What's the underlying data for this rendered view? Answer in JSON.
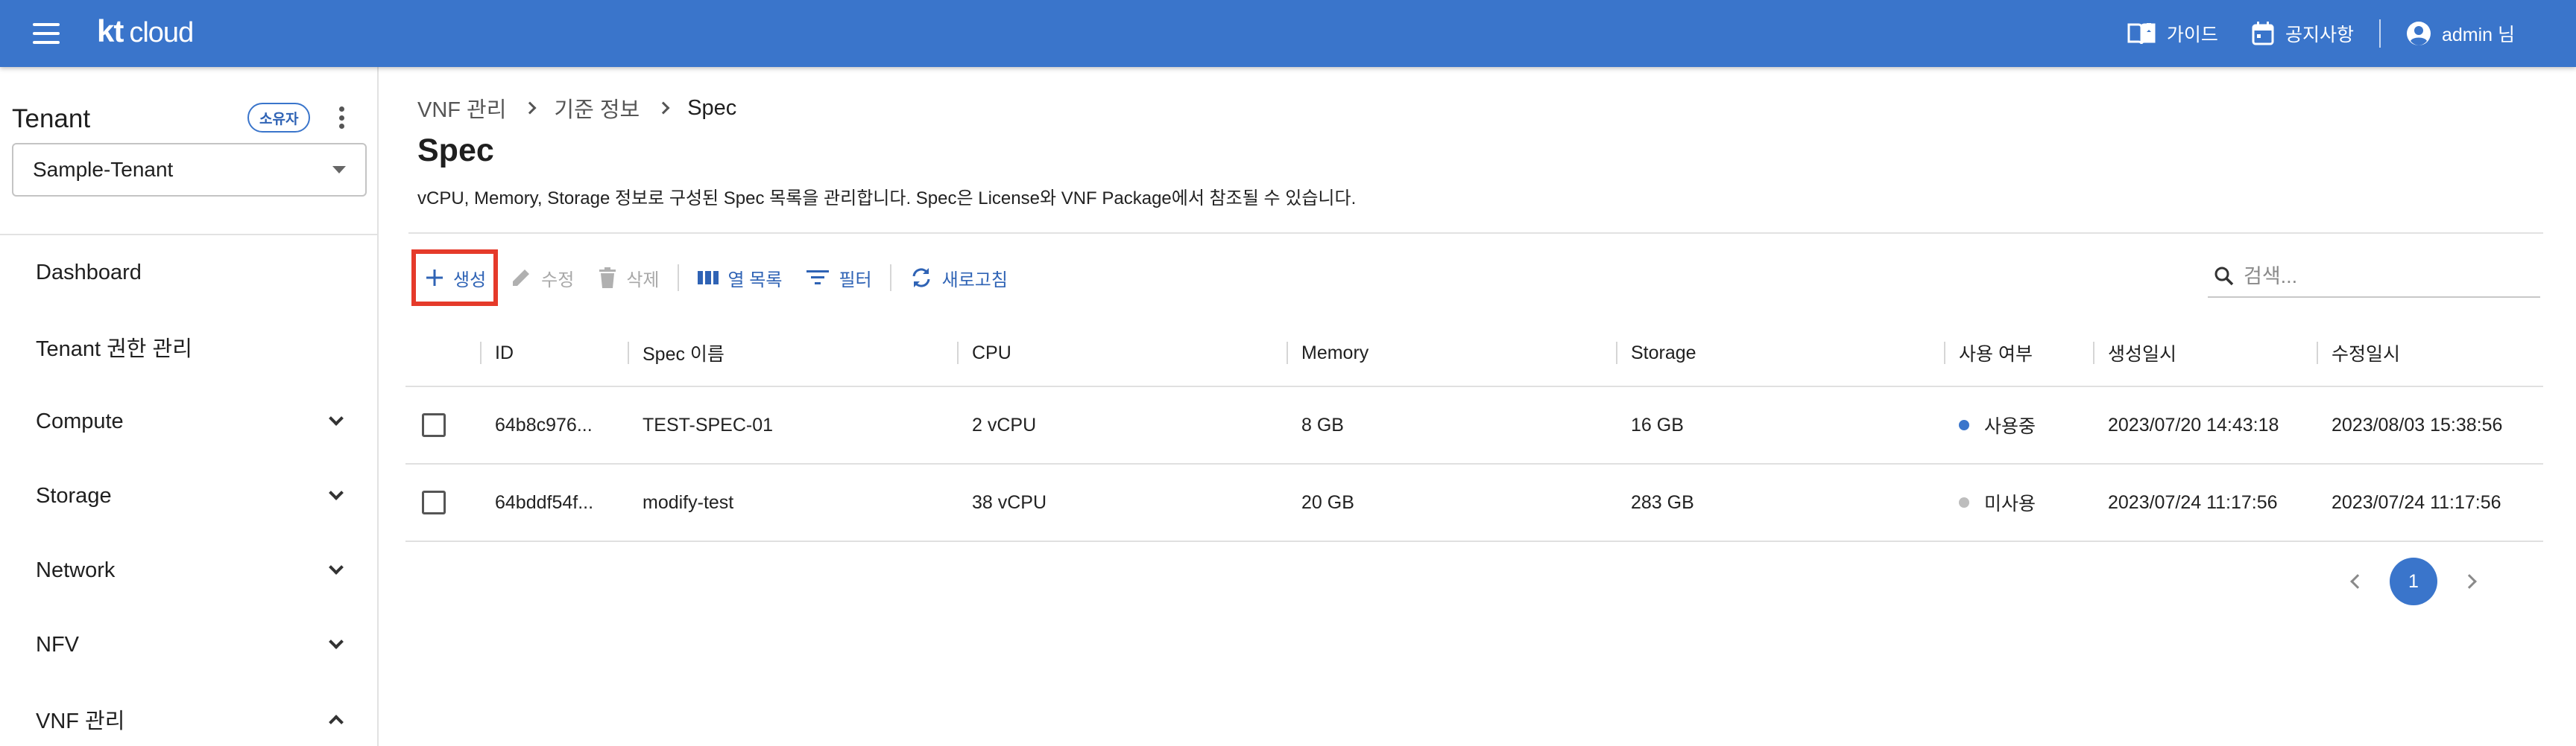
{
  "header": {
    "logo_kt": "kt",
    "logo_cloud": "cloud",
    "guide_label": "가이드",
    "notice_label": "공지사항",
    "user_label": "admin 님"
  },
  "sidebar": {
    "tenant_title": "Tenant",
    "owner_badge": "소유자",
    "tenant_selected": "Sample-Tenant",
    "items": [
      {
        "label": "Dashboard"
      },
      {
        "label": "Tenant 권한 관리"
      },
      {
        "label": "Compute"
      },
      {
        "label": "Storage"
      },
      {
        "label": "Network"
      },
      {
        "label": "NFV"
      },
      {
        "label": "VNF 관리"
      }
    ]
  },
  "breadcrumb": {
    "level1": "VNF 관리",
    "level2": "기준 정보",
    "current": "Spec"
  },
  "page": {
    "title": "Spec",
    "description": "vCPU, Memory, Storage 정보로 구성된 Spec 목록을 관리합니다. Spec은 License와 VNF Package에서 참조될 수 있습니다."
  },
  "toolbar": {
    "create_label": "생성",
    "edit_label": "수정",
    "delete_label": "삭제",
    "columns_label": "열 목록",
    "filter_label": "필터",
    "refresh_label": "새로고침",
    "search_placeholder": "검색..."
  },
  "table": {
    "columns": [
      "ID",
      "Spec 이름",
      "CPU",
      "Memory",
      "Storage",
      "사용 여부",
      "생성일시",
      "수정일시"
    ],
    "rows": [
      {
        "id": "64b8c976...",
        "name": "TEST-SPEC-01",
        "cpu": "2 vCPU",
        "memory": "8 GB",
        "storage": "16 GB",
        "status": "사용중",
        "status_color": "#3a75cb",
        "created": "2023/07/20 14:43:18",
        "updated": "2023/08/03 15:38:56"
      },
      {
        "id": "64bddf54f...",
        "name": "modify-test",
        "cpu": "38 vCPU",
        "memory": "20 GB",
        "storage": "283 GB",
        "status": "미사용",
        "status_color": "#bdbdbd",
        "created": "2023/07/24 11:17:56",
        "updated": "2023/07/24 11:17:56"
      }
    ]
  },
  "pagination": {
    "current_page": "1"
  },
  "colors": {
    "brand": "#3a75cb",
    "highlight": "#e53a2a"
  }
}
